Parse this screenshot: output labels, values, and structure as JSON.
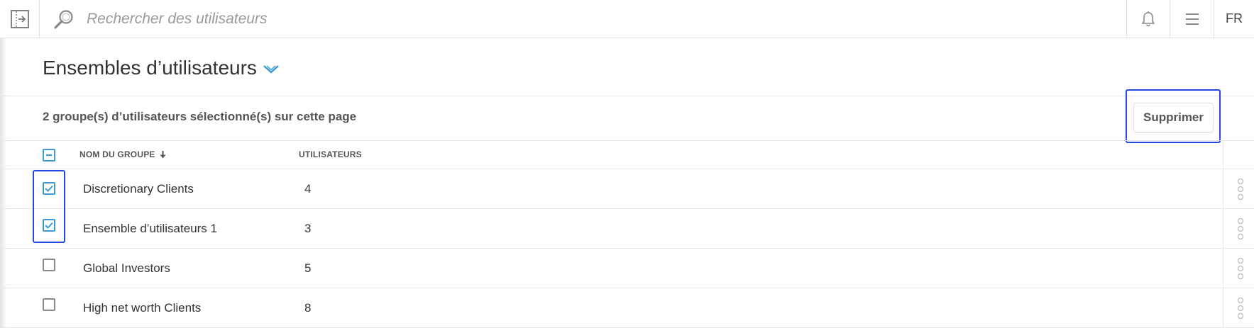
{
  "topbar": {
    "search_placeholder": "Rechercher des utilisateurs",
    "language": "FR"
  },
  "header": {
    "title": "Ensembles d’utilisateurs"
  },
  "selection": {
    "text": "2 groupe(s) d’utilisateurs sélectionné(s) sur cette page",
    "delete_label": "Supprimer"
  },
  "table": {
    "columns": {
      "name": "NOM DU GROUPE",
      "users": "UTILISATEURS"
    },
    "header_checkbox_state": "indeterminate",
    "rows": [
      {
        "name": "Discretionary Clients",
        "users": "4",
        "checked": true
      },
      {
        "name": "Ensemble d’utilisateurs 1",
        "users": "3",
        "checked": true
      },
      {
        "name": "Global Investors",
        "users": "5",
        "checked": false
      },
      {
        "name": "High net worth Clients",
        "users": "8",
        "checked": false
      }
    ]
  },
  "icons": {
    "collapse": "sidebar-expand-icon",
    "search": "search-icon",
    "bell": "bell-icon",
    "menu": "hamburger-menu-icon",
    "title_chevron": "chevron-down-icon",
    "sort": "sort-arrow-down-icon",
    "row_menu": "kebab-menu-icon"
  },
  "colors": {
    "accent": "#3d9ad1",
    "highlight": "#2348e6"
  }
}
